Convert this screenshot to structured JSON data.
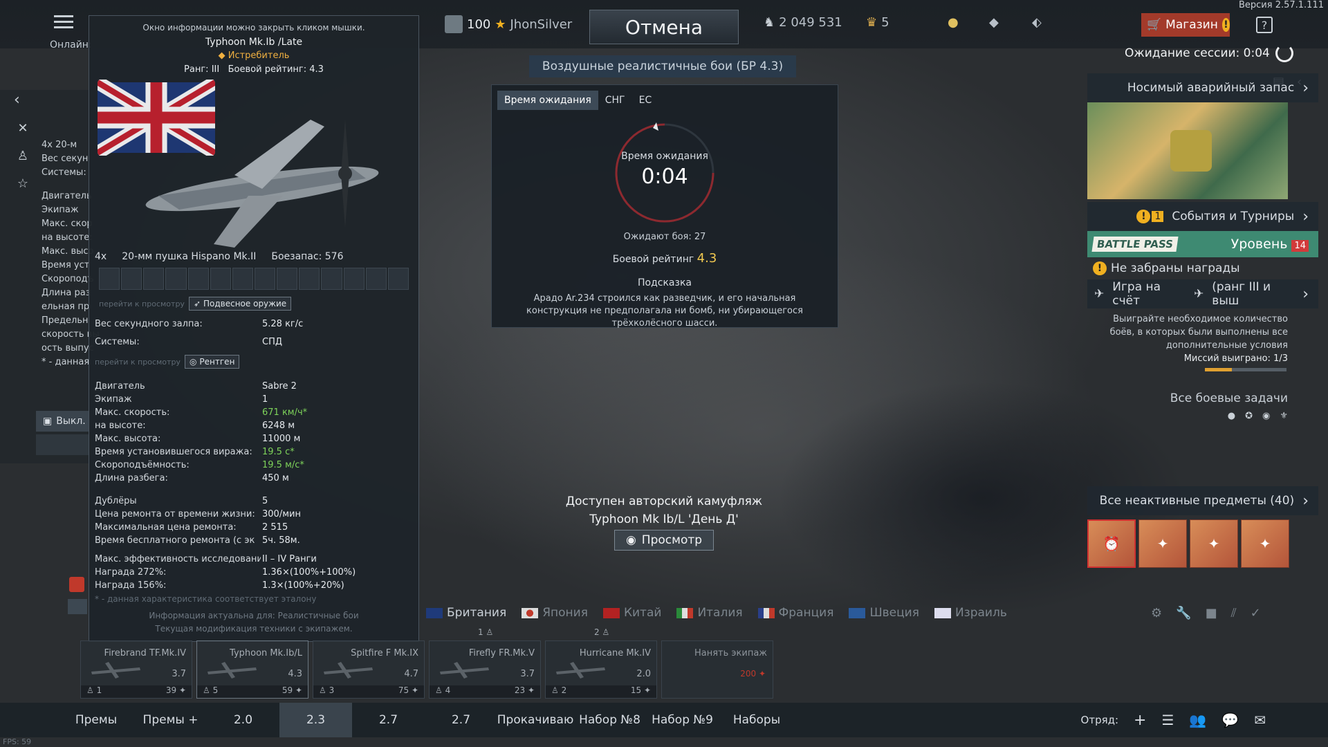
{
  "header": {
    "version": "Версия 2.57.1.111",
    "online_label": "Онлайн:",
    "level": "100",
    "username": "JhonSilver",
    "cancel_label": "Отмена",
    "silver_lions": "2 049 531",
    "golden_eagles": "5",
    "shop_label": "Магазин",
    "help_label": "?",
    "mode": "Воздушные реалистичные бои (БР 4.3)",
    "session_wait": "Ожидание сессии: 0:04"
  },
  "info_panel": {
    "close_hint": "Окно информации можно закрыть кликом мышки.",
    "vehicle_name": "Typhoon Mk.Ib /Late",
    "vehicle_class": "Истребитель",
    "rank_label": "Ранг:",
    "rank": "III",
    "br_label": "Боевой рейтинг:",
    "br": "4.3",
    "weapon_count": "4x",
    "weapon_name": "20-мм пушка Hispano Mk.II",
    "ammo_label": "Боезапас:",
    "ammo": "576",
    "go_view": "перейти к просмотру",
    "suspended_weapons": "Подвесное оружие",
    "xray": "Рентген",
    "salvo_label": "Вес секундного залпа:",
    "salvo": "5.28 кг/с",
    "systems_label": "Системы:",
    "systems": "СПД",
    "stats": [
      {
        "k": "Двигатель",
        "v": "Sabre 2",
        "green": false
      },
      {
        "k": "Экипаж",
        "v": "1",
        "green": false
      },
      {
        "k": "Макс. скорость:",
        "v": "671 км/ч*",
        "green": true
      },
      {
        "k": "на высоте:",
        "v": "6248 м",
        "green": false
      },
      {
        "k": "Макс. высота:",
        "v": "11000 м",
        "green": false
      },
      {
        "k": "Время установившегося виража:",
        "v": "19.5 с*",
        "green": true
      },
      {
        "k": "Скороподъёмность:",
        "v": "19.5 м/с*",
        "green": true
      },
      {
        "k": "Длина разбега:",
        "v": "450 м",
        "green": false
      }
    ],
    "economy": [
      {
        "k": "Дублёры",
        "v": "5"
      },
      {
        "k": "Цена ремонта от времени жизни:",
        "v": "300/мин"
      },
      {
        "k": "Максимальная цена ремонта:",
        "v": "2 515"
      },
      {
        "k": "Время бесплатного ремонта (с эк",
        "v": "5ч. 58м."
      },
      {
        "k": "Макс. эффективность исследовани",
        "v": "II – IV Ранги"
      },
      {
        "k": "Награда 272%:",
        "v": "1.36×(100%+100%)"
      },
      {
        "k": "Награда 156%:",
        "v": "1.3×(100%+20%)"
      }
    ],
    "footnote": "* - данная характеристика соответствует эталону",
    "actual_line1": "Информация актуальна для: Реалистичные бои",
    "actual_line2": "Текущая модификация техники с экипажем."
  },
  "left_side": {
    "rows": [
      "4x   20-м",
      "Вес секун",
      "Системы:",
      "Двигатель",
      "Экипаж",
      "Макс. скор",
      "на высоте:",
      "Макс. высо",
      "Время уст",
      "Скороподъ",
      "Длина раз",
      "ельная пр",
      "Предельн",
      "скорость вы",
      "ость выпус",
      "* - данная"
    ],
    "toggle": "Выкл."
  },
  "queue": {
    "tabs": [
      "Время ожидания",
      "СНГ",
      "ЕС"
    ],
    "time_label": "Время ожидания",
    "time": "0:04",
    "waiting": "Ожидают боя: 27",
    "br_label": "Боевой рейтинг",
    "br": "4.3",
    "tip_title": "Подсказка",
    "tip": "Арадо Ar.234 строился как разведчик, и его начальная конструкция не предполагала ни бомб, ни убирающегося трёхколёсного шасси."
  },
  "right_panel": {
    "emergency_kit": "Носимый аварийный запас",
    "events": "События и Турниры",
    "events_count": "1",
    "battle_pass_logo": "BATTLE PASS",
    "level_label": "Уровень",
    "level": "14",
    "unclaimed": "Не забраны награды",
    "play_for": "Игра на счёт",
    "play_for_rank": "(ранг III и выш",
    "desc": "Выиграйте необходимое количество боёв, в которых были выполнены все дополнительные условия",
    "missions": "Миссий выиграно: 1/3",
    "missions_progress": 0.33,
    "all_tasks": "Все боевые задачи",
    "inactive_items": "Все неактивные предметы (40)"
  },
  "camo": {
    "line1": "Доступен авторский камуфляж",
    "line2": "Typhoon Mk Ib/L 'День Д'",
    "view_label": "Просмотр"
  },
  "nations": [
    "Британия",
    "Япония",
    "Китай",
    "Италия",
    "Франция",
    "Швеция",
    "Израиль"
  ],
  "slots": [
    {
      "name": "Firebrand TF.Mk.IV",
      "br": "3.7",
      "crew": "1",
      "cost": "39",
      "top": ""
    },
    {
      "name": "Typhoon Mk.Ib/L",
      "br": "4.3",
      "crew": "5",
      "cost": "59",
      "top": ""
    },
    {
      "name": "Spitfire F Mk.IX",
      "br": "4.7",
      "crew": "3",
      "cost": "75",
      "top": ""
    },
    {
      "name": "Firefly FR.Mk.V",
      "br": "3.7",
      "crew": "4",
      "cost": "23",
      "top": "1"
    },
    {
      "name": "Hurricane Mk.IV",
      "br": "2.0",
      "crew": "2",
      "cost": "15",
      "top": "2"
    }
  ],
  "hire_crew": {
    "label": "Нанять экипаж",
    "cost": "200"
  },
  "bottom_tabs": [
    {
      "label": "Премы",
      "width": 110,
      "active": false
    },
    {
      "label": "Премы +",
      "width": 105,
      "active": false
    },
    {
      "label": "2.0",
      "width": 105,
      "active": false
    },
    {
      "label": "2.3",
      "width": 105,
      "active": true
    },
    {
      "label": "2.7",
      "width": 105,
      "active": false
    },
    {
      "label": "2.7",
      "width": 105,
      "active": false
    },
    {
      "label": "Прокачиваю",
      "width": 110,
      "active": false
    },
    {
      "label": "Набор №8",
      "width": 105,
      "active": false
    },
    {
      "label": "Набор №9",
      "width": 105,
      "active": false
    },
    {
      "label": "Наборы",
      "width": 110,
      "active": false
    }
  ],
  "squad_label": "Отряд:",
  "fps": "FPS: 59"
}
